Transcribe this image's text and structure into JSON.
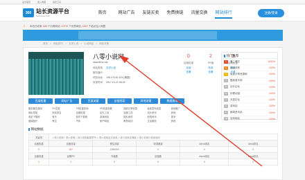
{
  "topbar": {
    "links": [
      "设为首页",
      "加入收藏",
      "站长工具"
    ]
  },
  "header": {
    "logo_badge": "360",
    "logo_title": "站长资源平台",
    "logo_sub": "www.seee.com",
    "nav": [
      "首页",
      "网站广告",
      "友链买卖",
      "免费换链",
      "流量交换",
      "网站排行"
    ],
    "active_nav": 5,
    "login_label": "注册/登录"
  },
  "notice": {
    "prefix": "本站已收录:",
    "count1": "633",
    "mid1": "个分类网站,",
    "count2": "47272",
    "mid2": "个优秀网站,",
    "count3": "1819",
    "suffix": "个站点加入网盟"
  },
  "breadcrumb": [
    "首页",
    ">",
    "网站排行",
    ">",
    "文学小说",
    ">",
    "小说网站",
    ">",
    "网站详情"
  ],
  "site": {
    "title": "八零小说网",
    "title_icon": "lock-icon",
    "url": "www.80xs.me",
    "rows": [
      {
        "label": "网站类型:",
        "value": "文学小说",
        "link": true
      },
      {
        "label": "服务器IP:",
        "value": "",
        "link": false
      },
      {
        "label": "网站地址:",
        "value": "196.176.52.124 (美国)",
        "link": false
      },
      {
        "label": "收录时间:",
        "value": "2017-10-21 08:02",
        "link": false
      }
    ]
  },
  "stats": [
    {
      "num": "0",
      "label": "百度权重"
    },
    {
      "num": "2",
      "label": "PR值"
    },
    {
      "num": "0",
      "label": "谷歌权重"
    }
  ],
  "stat_links": [
    [
      "反链",
      "收录",
      "排名"
    ],
    [
      "查看",
      "查看",
      "查看"
    ]
  ],
  "hot": {
    "title": "热门推荐",
    "items": [
      {
        "rank": "1",
        "name": "第二博文",
        "val": "1001%"
      },
      {
        "rank": "2",
        "name": "新浪体育",
        "val": "100%"
      },
      {
        "rank": "3",
        "name": "免费分享资源网",
        "val": "100%"
      },
      {
        "rank": "4",
        "name": "酷我音乐网",
        "val": "100%"
      },
      {
        "rank": "5",
        "name": "站长论坛",
        "val": "100%"
      },
      {
        "rank": "6",
        "name": "好看动漫",
        "val": "100%"
      },
      {
        "rank": "7",
        "name": "天涯论坛",
        "val": "100%"
      },
      {
        "rank": "8",
        "name": "游戏站",
        "val": "100%"
      },
      {
        "rank": "9",
        "name": "新闻资讯站",
        "val": "100%"
      },
      {
        "rank": "10",
        "name": "百科网站",
        "val": "100%"
      }
    ]
  },
  "actions": [
    "百度权重",
    "网站广告",
    "百度流量",
    "友链档案",
    "其他流量",
    "数据查询"
  ],
  "categories": [
    [
      "服务器交易网",
      "PR交易",
      "PR权重查询",
      "PR权重查看",
      "搜索引擎收录",
      "免费发布信息",
      "其他推广"
    ],
    [
      "网址导航",
      "网站排名",
      "百度权重",
      "站长工具",
      "百度工具",
      "站长资讯",
      "其他"
    ],
    [
      "电影下载网",
      "音乐",
      "软件下载网",
      "游戏网站",
      "图片素材",
      "影视资讯",
      "更多"
    ],
    [
      "健康医疗",
      "养生",
      "汽车",
      "房产网站",
      "教育培训",
      "生活服务",
      "其他"
    ]
  ],
  "section_title": "网站数据",
  "grid": {
    "note_label": "关键词",
    "note": "八零小说网八零小说网,八零小说网最新章节,八零小说网全文阅读,八零小说网无弹窗,八零小说网小说阅读网",
    "head1": [
      "百度权重",
      "百度流量",
      "预估流量",
      "收录数量",
      "Alexa排名",
      "Alexa排名"
    ],
    "row1": [
      "0",
      "187",
      "1280000",
      "0",
      "0",
      "0"
    ],
    "head2": [
      "百度权重",
      "谷歌PR",
      "外链数",
      "反链数",
      "Alexa排名",
      "Alexa排名"
    ],
    "row2": [
      "0",
      "2",
      "0",
      "0",
      "0",
      "0"
    ]
  }
}
